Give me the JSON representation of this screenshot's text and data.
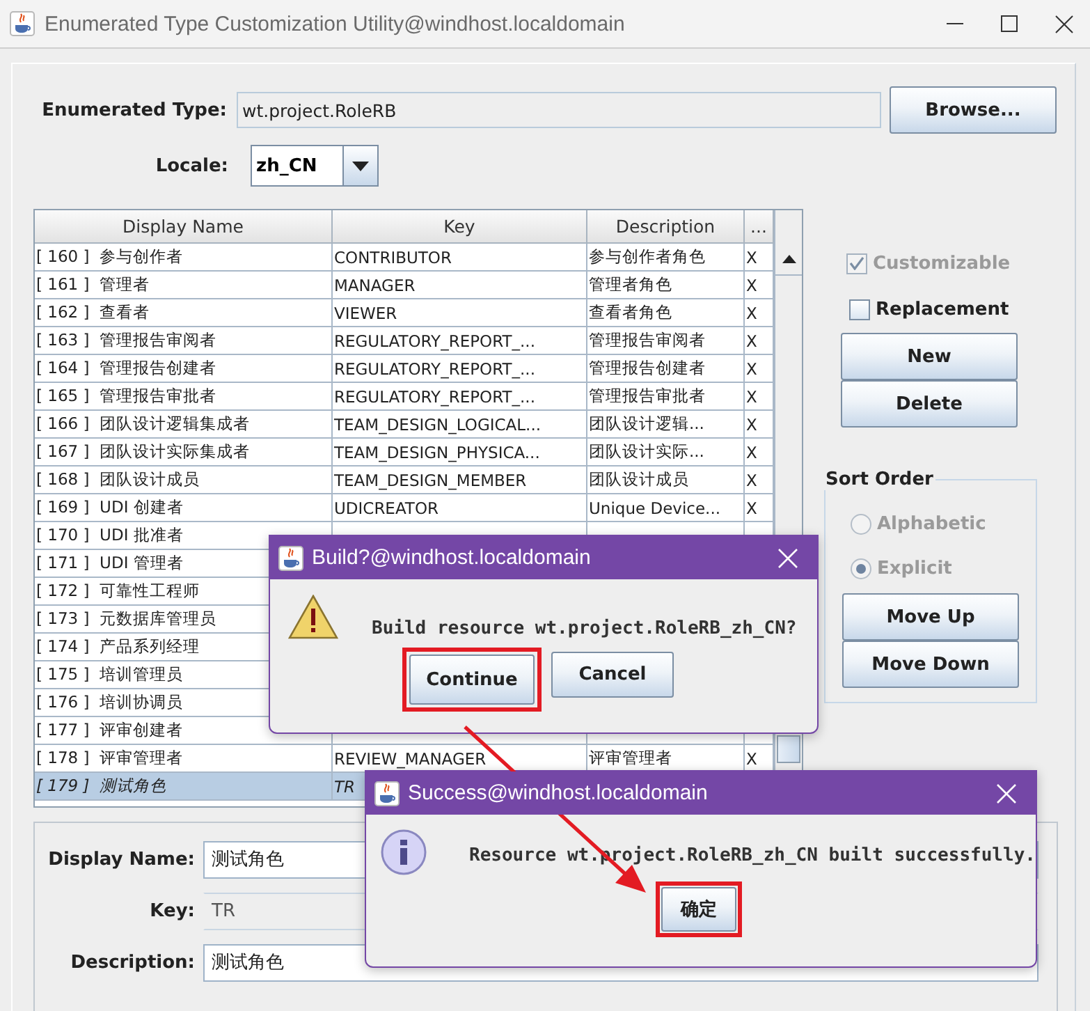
{
  "window": {
    "title": "Enumerated Type Customization Utility@windhost.localdomain"
  },
  "type_form": {
    "type_label": "Enumerated Type:",
    "type_value": "wt.project.RoleRB",
    "browse_button": "Browse...",
    "locale_label": "Locale:",
    "locale_value": "zh_CN"
  },
  "table": {
    "columns": [
      "Display Name",
      "Key",
      "Description",
      "..."
    ],
    "rows": [
      {
        "display_name": "[ 160 ]  参与创作者",
        "key": "CONTRIBUTOR",
        "description": "参与创作者角色",
        "column_4": "X",
        "selected": false
      },
      {
        "display_name": "[ 161 ]  管理者",
        "key": "MANAGER",
        "description": "管理者角色",
        "column_4": "X",
        "selected": false
      },
      {
        "display_name": "[ 162 ]  查看者",
        "key": "VIEWER",
        "description": "查看者角色",
        "column_4": "X",
        "selected": false
      },
      {
        "display_name": "[ 163 ]  管理报告审阅者",
        "key": "REGULATORY_REPORT_...",
        "description": "管理报告审阅者",
        "column_4": "X",
        "selected": false
      },
      {
        "display_name": "[ 164 ]  管理报告创建者",
        "key": "REGULATORY_REPORT_...",
        "description": "管理报告创建者",
        "column_4": "X",
        "selected": false
      },
      {
        "display_name": "[ 165 ]  管理报告审批者",
        "key": "REGULATORY_REPORT_...",
        "description": "管理报告审批者",
        "column_4": "X",
        "selected": false
      },
      {
        "display_name": "[ 166 ]  团队设计逻辑集成者",
        "key": "TEAM_DESIGN_LOGICAL...",
        "description": "团队设计逻辑...",
        "column_4": "X",
        "selected": false
      },
      {
        "display_name": "[ 167 ]  团队设计实际集成者",
        "key": "TEAM_DESIGN_PHYSICA...",
        "description": "团队设计实际...",
        "column_4": "X",
        "selected": false
      },
      {
        "display_name": "[ 168 ]  团队设计成员",
        "key": "TEAM_DESIGN_MEMBER",
        "description": "团队设计成员",
        "column_4": "X",
        "selected": false
      },
      {
        "display_name": "[ 169 ]  UDI 创建者",
        "key": "UDICREATOR",
        "description": "Unique Device...",
        "column_4": "X",
        "selected": false
      },
      {
        "display_name": "[ 170 ]  UDI 批准者",
        "selected": false
      },
      {
        "display_name": "[ 171 ]  UDI 管理者",
        "selected": false
      },
      {
        "display_name": "[ 172 ]  可靠性工程师",
        "selected": false
      },
      {
        "display_name": "[ 173 ]  元数据库管理员",
        "selected": false
      },
      {
        "display_name": "[ 174 ]  产品系列经理",
        "selected": false
      },
      {
        "display_name": "[ 175 ]  培训管理员",
        "selected": false
      },
      {
        "display_name": "[ 176 ]  培训协调员",
        "selected": false
      },
      {
        "display_name": "[ 177 ]  评审创建者",
        "selected": false
      },
      {
        "display_name": "[ 178 ]  评审管理者",
        "key": "REVIEW_MANAGER",
        "description": "评审管理者",
        "column_4": "X",
        "selected": false
      },
      {
        "display_name": "[ 179 ]  测试角色",
        "key": "TR",
        "selected": true
      }
    ]
  },
  "side_panel": {
    "options": [
      {
        "label": "Customizable",
        "checked": true,
        "disabled": true
      },
      {
        "label": "Replacement",
        "checked": false,
        "disabled": false
      }
    ],
    "buttons": [
      "New",
      "Delete"
    ]
  },
  "sort_order": {
    "title": "Sort Order",
    "disabled": true,
    "options": [
      {
        "label": "Alphabetic",
        "selected": false
      },
      {
        "label": "Explicit",
        "selected": true
      }
    ],
    "buttons": [
      "Move Up",
      "Move Down"
    ]
  },
  "details": {
    "fields": [
      {
        "label": "Display Name:",
        "value": "测试角色",
        "editable": true
      },
      {
        "label": "Key:",
        "value": "TR",
        "editable": false
      },
      {
        "label": "Description:",
        "value": "测试角色",
        "editable": true
      }
    ]
  },
  "dialogs": [
    {
      "title": "Build?@windhost.localdomain",
      "kind": "warning",
      "message": "Build resource wt.project.RoleRB_zh_CN?",
      "buttons": [
        {
          "label": "Continue",
          "highlighted": true
        },
        {
          "label": "Cancel",
          "highlighted": false
        }
      ]
    },
    {
      "title": "Success@windhost.localdomain",
      "kind": "info",
      "message": "Resource wt.project.RoleRB_zh_CN built successfully.",
      "buttons": [
        {
          "label": "确定",
          "highlighted": true
        }
      ]
    }
  ]
}
